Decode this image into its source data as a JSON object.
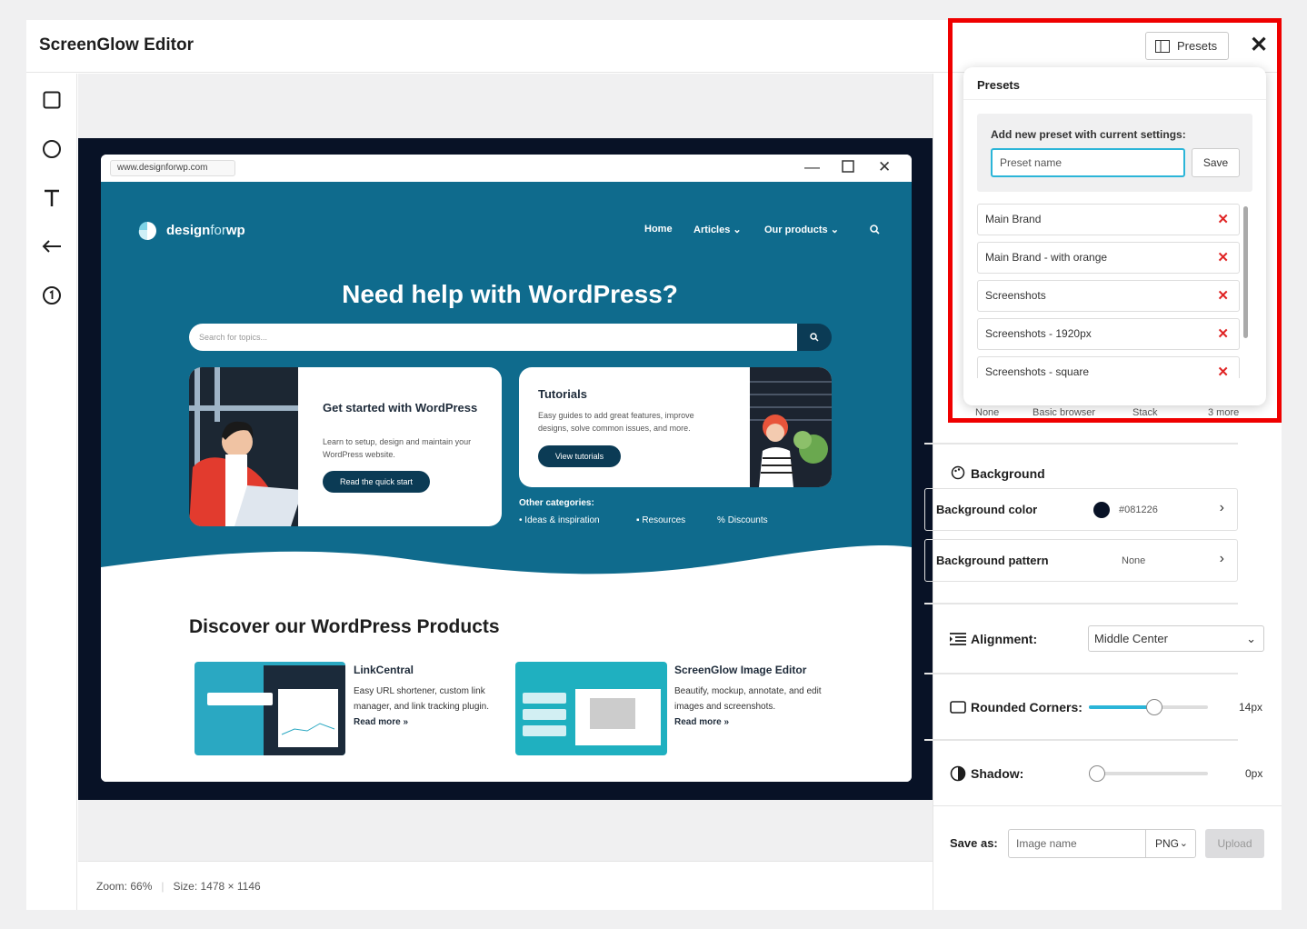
{
  "app": {
    "title": "ScreenGlow Editor",
    "close_label": "✕",
    "presets_button": "Presets"
  },
  "status": {
    "zoom": "Zoom: 66%",
    "size": "Size: 1478 × 1146"
  },
  "screenshot": {
    "url": "www.designforwp.com",
    "logo_a": "design",
    "logo_b": "for",
    "logo_c": "wp",
    "nav": [
      "Home",
      "Articles",
      "Our products"
    ],
    "hero_title": "Need help with WordPress?",
    "search_placeholder": "Search for topics...",
    "card1": {
      "title": "Get started with WordPress",
      "text": "Learn to setup, design and maintain your WordPress website.",
      "button": "Read the quick start"
    },
    "card2": {
      "title": "Tutorials",
      "text": "Easy guides to add great features, improve designs, solve common issues, and more.",
      "button": "View tutorials"
    },
    "other_categories": "Other categories:",
    "categories": [
      "Ideas & inspiration",
      "Resources",
      "Discounts"
    ],
    "discover_title": "Discover our WordPress Products",
    "products": [
      {
        "title": "LinkCentral",
        "text": "Easy URL shortener, custom link manager, and link tracking plugin.",
        "more": "Read more »"
      },
      {
        "title": "ScreenGlow Image Editor",
        "text": "Beautify, mockup, annotate, and edit images and screenshots.",
        "more": "Read more »"
      }
    ]
  },
  "presets_panel": {
    "title": "Presets",
    "add_label": "Add new preset with current settings:",
    "name_placeholder": "Preset name",
    "save_label": "Save",
    "items": [
      "Main Brand",
      "Main Brand - with orange",
      "Screenshots",
      "Screenshots - 1920px",
      "Screenshots - square"
    ],
    "peek": [
      "None",
      "Basic browser",
      "Stack",
      "3 more"
    ]
  },
  "background": {
    "section_label": "Background",
    "color_label": "Background color",
    "color_value": "#081226",
    "pattern_label": "Background pattern",
    "pattern_value": "None"
  },
  "alignment": {
    "label": "Alignment:",
    "value": "Middle Center"
  },
  "rounded": {
    "label": "Rounded Corners:",
    "value": "14px",
    "fraction": 0.55
  },
  "shadow": {
    "label": "Shadow:",
    "value": "0px",
    "fraction": 0
  },
  "save": {
    "label": "Save as:",
    "placeholder": "Image name",
    "format": "PNG",
    "upload": "Upload"
  },
  "colors": {
    "accent": "#2bb5d8",
    "highlight": "#ef0000",
    "delete": "#e02424",
    "hero": "#0f6b8d"
  }
}
